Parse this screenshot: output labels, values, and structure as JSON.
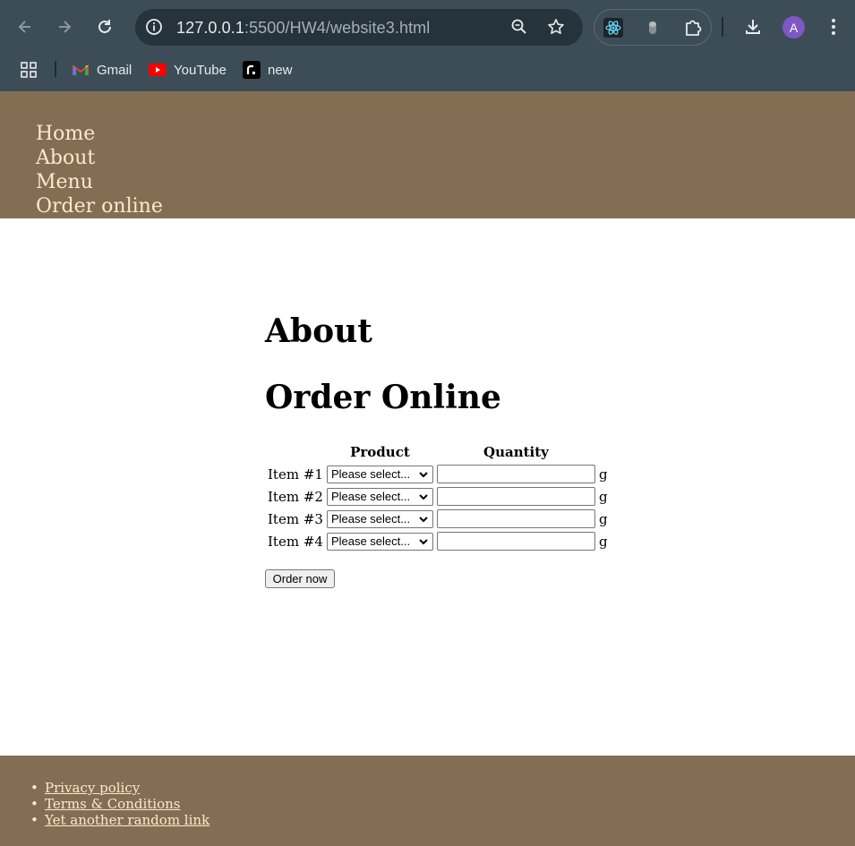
{
  "browser": {
    "url_host": "127.0.0.1",
    "url_rest": ":5500/HW4/website3.html",
    "avatar_letter": "A",
    "bookmarks": [
      {
        "label": "Gmail",
        "icon": "gmail-icon"
      },
      {
        "label": "YouTube",
        "icon": "youtube-icon"
      },
      {
        "label": "new",
        "icon": "render-icon"
      }
    ]
  },
  "header": {
    "nav": [
      "Home",
      "About",
      "Menu",
      "Order online"
    ]
  },
  "main": {
    "about_heading": "About",
    "order_heading": "Order Online",
    "table": {
      "headers": [
        "Product",
        "Quantity"
      ],
      "rows": [
        {
          "label": "Item #1",
          "select": "Please select...",
          "unit": "g"
        },
        {
          "label": "Item #2",
          "select": "Please select...",
          "unit": "g"
        },
        {
          "label": "Item #3",
          "select": "Please select...",
          "unit": "g"
        },
        {
          "label": "Item #4",
          "select": "Please select...",
          "unit": "g"
        }
      ]
    },
    "order_button": "Order now"
  },
  "footer": {
    "links": [
      "Privacy policy",
      "Terms & Conditions",
      "Yet another random link"
    ]
  },
  "colors": {
    "chrome": "#3c4d57",
    "header_bg": "#846e53",
    "link_text": "#fde9c9"
  }
}
